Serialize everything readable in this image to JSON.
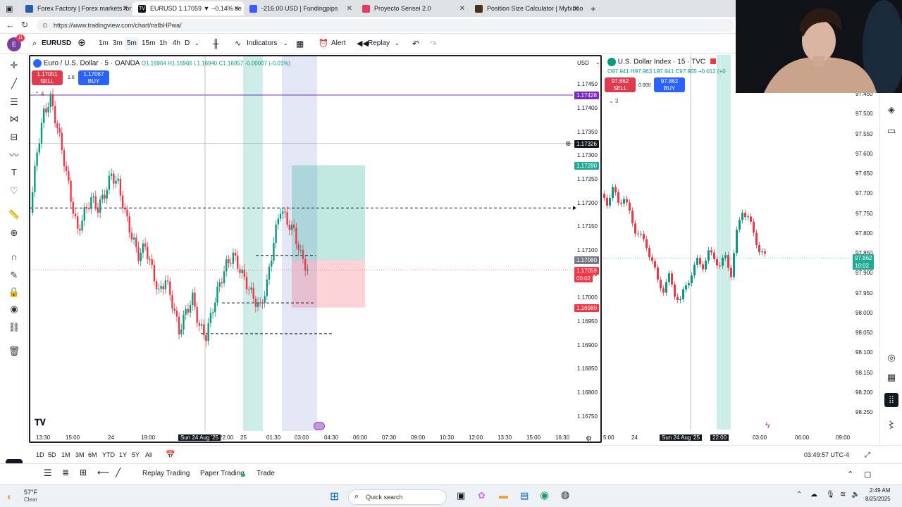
{
  "browser": {
    "tabs": [
      {
        "label": "Forex Factory | Forex markets for",
        "color": "#2b5ea8"
      },
      {
        "label": "EURUSD 1.17059 ▼ −0.14% se",
        "color": "#131722"
      },
      {
        "label": "-216.00 USD | Fundingpips",
        "color": "#3d5afe"
      },
      {
        "label": "Proyecto Sensei 2.0",
        "color": "#e23a61"
      },
      {
        "label": "Position Size Calculator | Myfxboo",
        "color": "#4a2f1b"
      }
    ],
    "url": "https://www.tradingview.com/chart/nsfbHPwa/"
  },
  "toolbar": {
    "symbol": "EURUSD",
    "intervals": [
      "1m",
      "3m",
      "5m",
      "15m",
      "1h",
      "4h",
      "D"
    ],
    "active_interval": "5m",
    "indicators_label": "Indicators",
    "alert_label": "Alert",
    "replay_label": "Replay",
    "avatar_badge": "11"
  },
  "chart_left": {
    "title": "Euro / U.S. Dollar · 5 · OANDA",
    "ohlc": "O1.16964 H1.16966 L1.16940 C1.16957 -0.00007 (-0.01%)",
    "currency": "USD",
    "sell_price": "1.17051",
    "buy_price": "1.17067",
    "spread": "1.6",
    "sell_label": "SELL",
    "buy_label": "BUY",
    "collapsed_count": "4",
    "price_ticks": [
      "1.17450",
      "1.17400",
      "1.17350",
      "1.17300",
      "1.17250",
      "1.17200",
      "1.17150",
      "1.17100",
      "1.17050",
      "1.17000",
      "1.16950",
      "1.16900",
      "1.16850",
      "1.16800",
      "1.16750"
    ],
    "badges": [
      {
        "text": "1.17428",
        "color": "#7b2cbf"
      },
      {
        "text": "1.17326",
        "color": "#131722"
      },
      {
        "text": "1.17280",
        "color": "#22ab94"
      },
      {
        "text": "1.17080",
        "color": "#787b86"
      },
      {
        "text": "1.17059",
        "color": "#f23645"
      },
      {
        "text": "00:02",
        "color": "#f23645"
      },
      {
        "text": "1.16980",
        "color": "#f23645"
      }
    ],
    "time_ticks": [
      "13:30",
      "15:00",
      "24",
      "19:00",
      "Sun 24 Aug '25",
      "22:00",
      "25",
      "01:30",
      "03:00",
      "04:30",
      "06:00",
      "07:30",
      "09:00",
      "10:30",
      "12:00",
      "13:30",
      "15:00",
      "16:30"
    ]
  },
  "chart_right": {
    "title": "U.S. Dollar Index · 15 · TVC",
    "ohlc": "O97.941 H97.963 L97.941 C97.955 +0.012 (+0",
    "sell_price": "97.862",
    "buy_price": "97.862",
    "spread": "0.000",
    "sell_label": "SELL",
    "buy_label": "BUY",
    "collapsed_count": "3",
    "price_ticks": [
      "97.450",
      "97.500",
      "97.550",
      "97.600",
      "97.650",
      "97.700",
      "97.750",
      "97.800",
      "97.850",
      "97.900",
      "97.950",
      "98.000",
      "98.050",
      "98.100",
      "98.150",
      "98.200",
      "98.250"
    ],
    "badge": {
      "price": "97.862",
      "timer": "10:02"
    },
    "time_ticks": [
      "5:00",
      "24",
      "Sun 24 Aug '25",
      "22:00",
      "03:00",
      "06:00",
      "09:00"
    ]
  },
  "bottom": {
    "ranges": [
      "1D",
      "5D",
      "1M",
      "3M",
      "6M",
      "YTD",
      "1Y",
      "5Y",
      "All"
    ],
    "clock": "03:49:57 UTC-4",
    "panel_tabs": [
      "Replay Trading",
      "Paper Trading",
      "Trade"
    ]
  },
  "taskbar": {
    "weather_temp": "57°F",
    "weather_desc": "Clear",
    "search_placeholder": "Quick search",
    "time": "2:49 AM",
    "date": "8/25/2025"
  },
  "chart_data": [
    {
      "type": "candlestick",
      "title": "Euro / U.S. Dollar · 5 · OANDA",
      "ylim": [
        1.1672,
        1.1748
      ],
      "close_path": [
        1.1718,
        1.1731,
        1.1739,
        1.1742,
        1.1736,
        1.1729,
        1.1721,
        1.1714,
        1.1718,
        1.1721,
        1.1719,
        1.1722,
        1.1726,
        1.1724,
        1.1718,
        1.1713,
        1.1709,
        1.1711,
        1.1706,
        1.1701,
        1.1704,
        1.1699,
        1.1693,
        1.1697,
        1.17,
        1.1694,
        1.1692,
        1.1698,
        1.1703,
        1.1707,
        1.1709,
        1.1706,
        1.1703,
        1.17,
        1.1698,
        1.1703,
        1.1712,
        1.1719,
        1.1716,
        1.1714,
        1.1709,
        1.1706
      ],
      "levels": [
        1.17428,
        1.17326,
        1.1728,
        1.1708,
        1.17059,
        1.1698
      ]
    },
    {
      "type": "candlestick",
      "title": "U.S. Dollar Index · 15 · TVC",
      "ylim": [
        97.45,
        98.25
      ],
      "close_path": [
        97.7,
        97.72,
        97.69,
        97.72,
        97.71,
        97.75,
        97.79,
        97.81,
        97.83,
        97.87,
        97.92,
        97.94,
        97.91,
        97.95,
        97.97,
        97.93,
        97.9,
        97.87,
        97.88,
        97.85,
        97.86,
        97.88,
        97.86,
        97.9,
        97.8,
        97.74,
        97.76,
        97.8,
        97.84,
        97.86
      ]
    }
  ]
}
